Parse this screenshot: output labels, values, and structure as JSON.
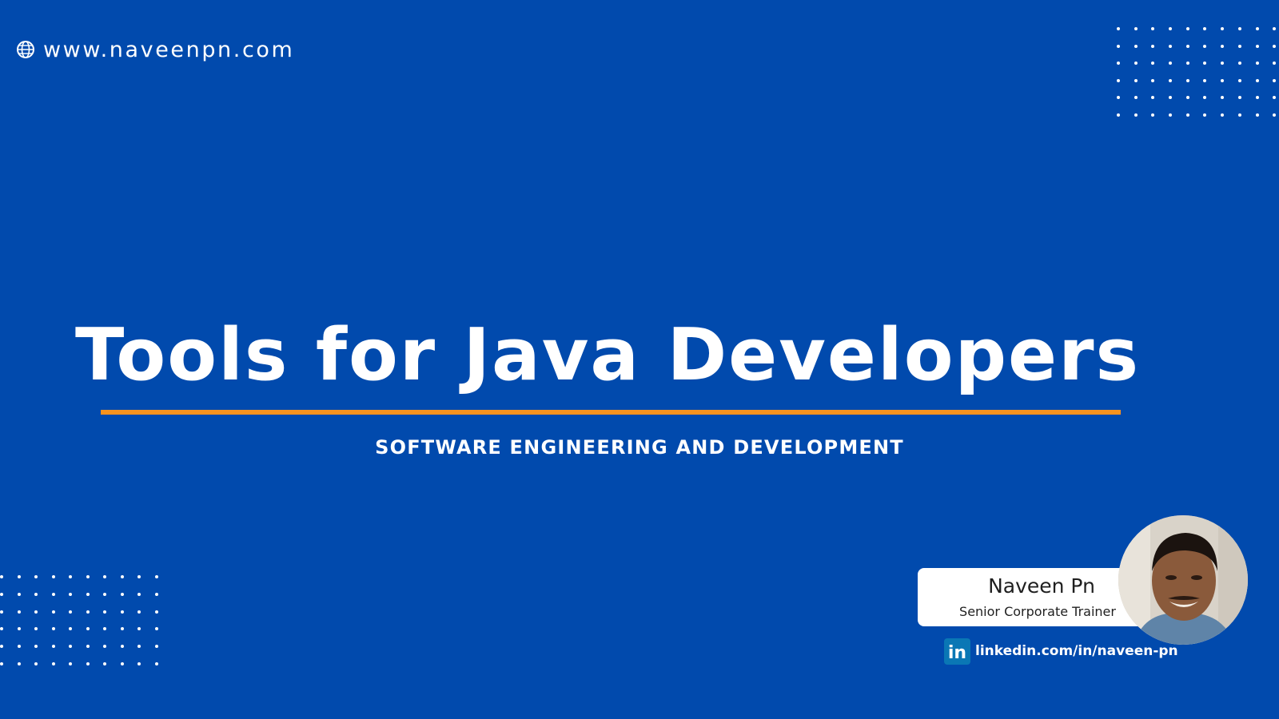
{
  "website": {
    "icon": "globe-icon",
    "url": "www.naveenpn.com"
  },
  "slide": {
    "title": "Tools for Java Developers",
    "subtitle": "SOFTWARE ENGINEERING AND DEVELOPMENT"
  },
  "presenter": {
    "name": "Naveen Pn",
    "role": "Senior Corporate Trainer",
    "linkedin_icon": "linkedin-icon",
    "linkedin_icon_text": "in",
    "linkedin_url": "linkedin.com/in/naveen-pn"
  },
  "colors": {
    "background": "#014aad",
    "accent": "#f7931e",
    "text": "#ffffff",
    "linkedin": "#0a77b5"
  }
}
